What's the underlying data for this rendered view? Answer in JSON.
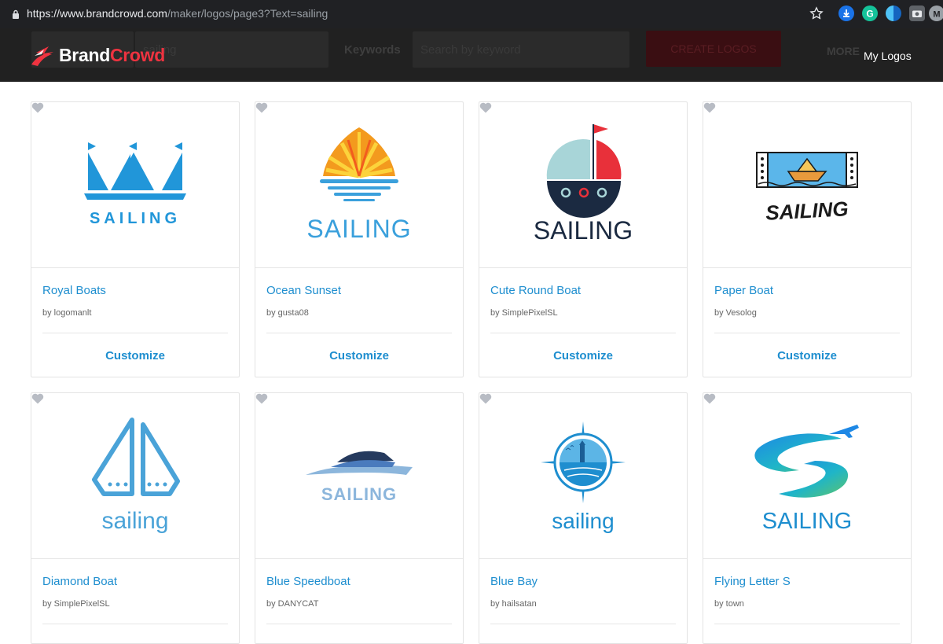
{
  "browser": {
    "url_host": "https://www.brandcrowd.com",
    "url_path": "/maker/logos/page3?Text=sailing"
  },
  "header": {
    "brand_part1": "Brand",
    "brand_part2": "Crowd",
    "my_logos": "My Logos",
    "hidden_search_text": "sailing",
    "keywords_label": "Keywords",
    "keywords_placeholder": "Search by keyword",
    "create_button": "CREATE LOGOS",
    "more_label": "MORE"
  },
  "customize_label": "Customize",
  "cards": [
    {
      "title": "Royal Boats",
      "author": "by logomanlt",
      "logo_text": "SAILING"
    },
    {
      "title": "Ocean Sunset",
      "author": "by gusta08",
      "logo_text": "SAILING"
    },
    {
      "title": "Cute Round Boat",
      "author": "by SimplePixelSL",
      "logo_text": "SAILING"
    },
    {
      "title": "Paper Boat",
      "author": "by Vesolog",
      "logo_text": "SAILING"
    },
    {
      "title": "Diamond Boat",
      "author": "by SimplePixelSL",
      "logo_text": "sailing"
    },
    {
      "title": "Blue Speedboat",
      "author": "by DANYCAT",
      "logo_text": "SAILING"
    },
    {
      "title": "Blue Bay",
      "author": "by hailsatan",
      "logo_text": "sailing"
    },
    {
      "title": "Flying Letter S",
      "author": "by town",
      "logo_text": "SAILING"
    }
  ],
  "colors": {
    "accent": "#1e8ecf",
    "brand_red": "#ef3340",
    "header_bg": "#1a1a1a"
  }
}
